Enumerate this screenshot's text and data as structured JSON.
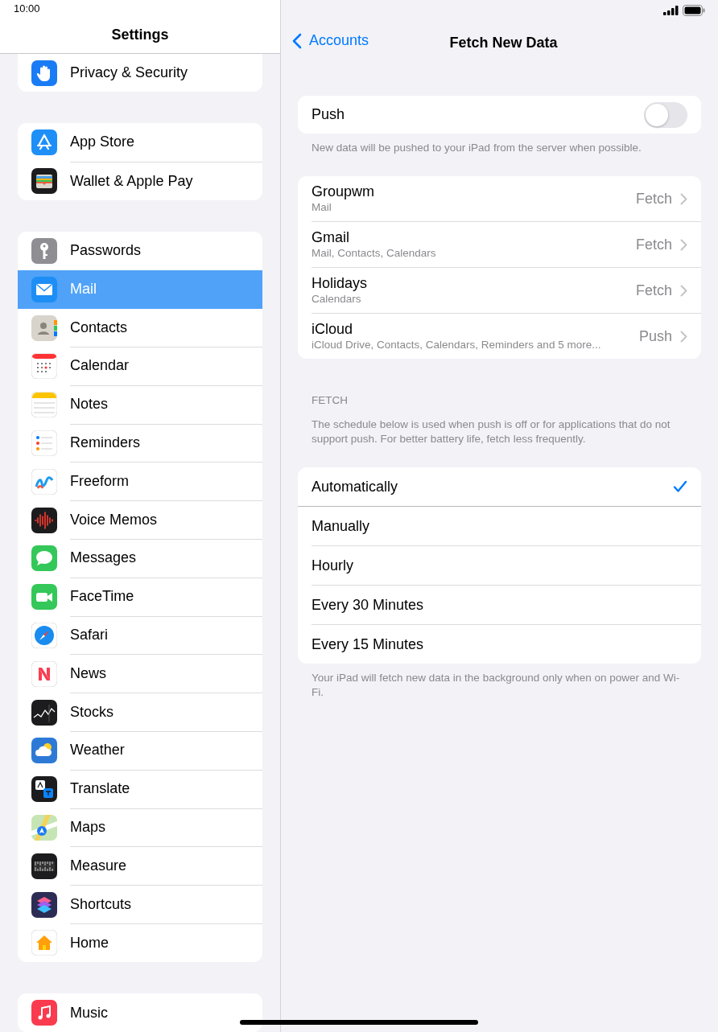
{
  "status_bar": {
    "time": "10:00"
  },
  "sidebar": {
    "title": "Settings",
    "groups": [
      {
        "items": [
          {
            "label": "Privacy & Security",
            "selected": false
          }
        ]
      },
      {
        "items": [
          {
            "label": "App Store",
            "selected": false
          },
          {
            "label": "Wallet & Apple Pay",
            "selected": false
          }
        ]
      },
      {
        "items": [
          {
            "label": "Passwords",
            "selected": false
          },
          {
            "label": "Mail",
            "selected": true
          },
          {
            "label": "Contacts",
            "selected": false
          },
          {
            "label": "Calendar",
            "selected": false
          },
          {
            "label": "Notes",
            "selected": false
          },
          {
            "label": "Reminders",
            "selected": false
          },
          {
            "label": "Freeform",
            "selected": false
          },
          {
            "label": "Voice Memos",
            "selected": false
          },
          {
            "label": "Messages",
            "selected": false
          },
          {
            "label": "FaceTime",
            "selected": false
          },
          {
            "label": "Safari",
            "selected": false
          },
          {
            "label": "News",
            "selected": false
          },
          {
            "label": "Stocks",
            "selected": false
          },
          {
            "label": "Weather",
            "selected": false
          },
          {
            "label": "Translate",
            "selected": false
          },
          {
            "label": "Maps",
            "selected": false
          },
          {
            "label": "Measure",
            "selected": false
          },
          {
            "label": "Shortcuts",
            "selected": false
          },
          {
            "label": "Home",
            "selected": false
          }
        ]
      },
      {
        "items": [
          {
            "label": "Music",
            "selected": false
          }
        ]
      }
    ]
  },
  "detail": {
    "back": "Accounts",
    "title": "Fetch New Data",
    "push": {
      "label": "Push",
      "on": false
    },
    "push_footer": "New data will be pushed to your iPad from the server when possible.",
    "accounts": [
      {
        "name": "Groupwm",
        "services": "Mail",
        "mode": "Fetch"
      },
      {
        "name": "Gmail",
        "services": "Mail, Contacts, Calendars",
        "mode": "Fetch"
      },
      {
        "name": "Holidays",
        "services": "Calendars",
        "mode": "Fetch"
      },
      {
        "name": "iCloud",
        "services": "iCloud Drive, Contacts, Calendars, Reminders and 5 more...",
        "mode": "Push"
      }
    ],
    "fetch_header": "FETCH",
    "fetch_description": "The schedule below is used when push is off or for applications that do not support push. For better battery life, fetch less frequently.",
    "schedule": [
      {
        "label": "Automatically",
        "selected": true
      },
      {
        "label": "Manually",
        "selected": false
      },
      {
        "label": "Hourly",
        "selected": false
      },
      {
        "label": "Every 30 Minutes",
        "selected": false
      },
      {
        "label": "Every 15 Minutes",
        "selected": false
      }
    ],
    "schedule_footer": "Your iPad will fetch new data in the background only when on power and Wi-Fi."
  }
}
